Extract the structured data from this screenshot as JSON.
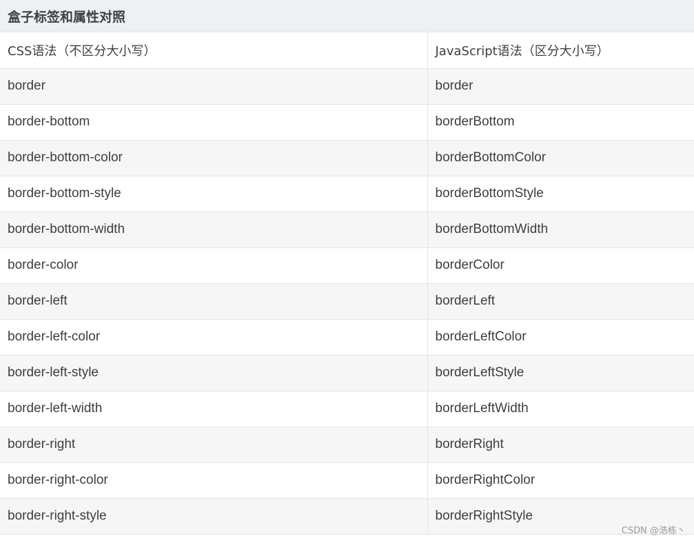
{
  "caption": "盒子标签和属性对照",
  "headers": [
    "CSS语法（不区分大小写）",
    "JavaScript语法（区分大小写）"
  ],
  "rows": [
    [
      "border",
      "border"
    ],
    [
      "border-bottom",
      "borderBottom"
    ],
    [
      "border-bottom-color",
      "borderBottomColor"
    ],
    [
      "border-bottom-style",
      "borderBottomStyle"
    ],
    [
      "border-bottom-width",
      "borderBottomWidth"
    ],
    [
      "border-color",
      "borderColor"
    ],
    [
      "border-left",
      "borderLeft"
    ],
    [
      "border-left-color",
      "borderLeftColor"
    ],
    [
      "border-left-style",
      "borderLeftStyle"
    ],
    [
      "border-left-width",
      "borderLeftWidth"
    ],
    [
      "border-right",
      "borderRight"
    ],
    [
      "border-right-color",
      "borderRightColor"
    ],
    [
      "border-right-style",
      "borderRightStyle"
    ]
  ],
  "watermark": "CSDN @浩栋丶",
  "colors": {
    "caption_bg": "#eef1f4",
    "row_alt_bg": "#f6f6f6",
    "row_bg": "#ffffff",
    "border": "#e4e4e4",
    "text": "#3d3d3d"
  }
}
